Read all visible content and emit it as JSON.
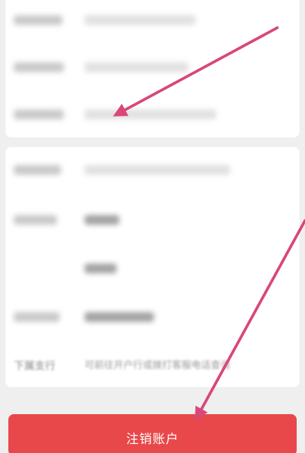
{
  "footer": {
    "cancel_account_label": "注销账户"
  },
  "card2": {
    "last_row_label": "下属支行",
    "last_row_value": "可前往开户行或拨打客服电话查询"
  },
  "colors": {
    "primary_button": "#e8484a",
    "annotation_arrow": "#d9477a",
    "background": "#efeff0",
    "card": "#ffffff"
  },
  "icons": {
    "annotation": "arrow-icon"
  }
}
